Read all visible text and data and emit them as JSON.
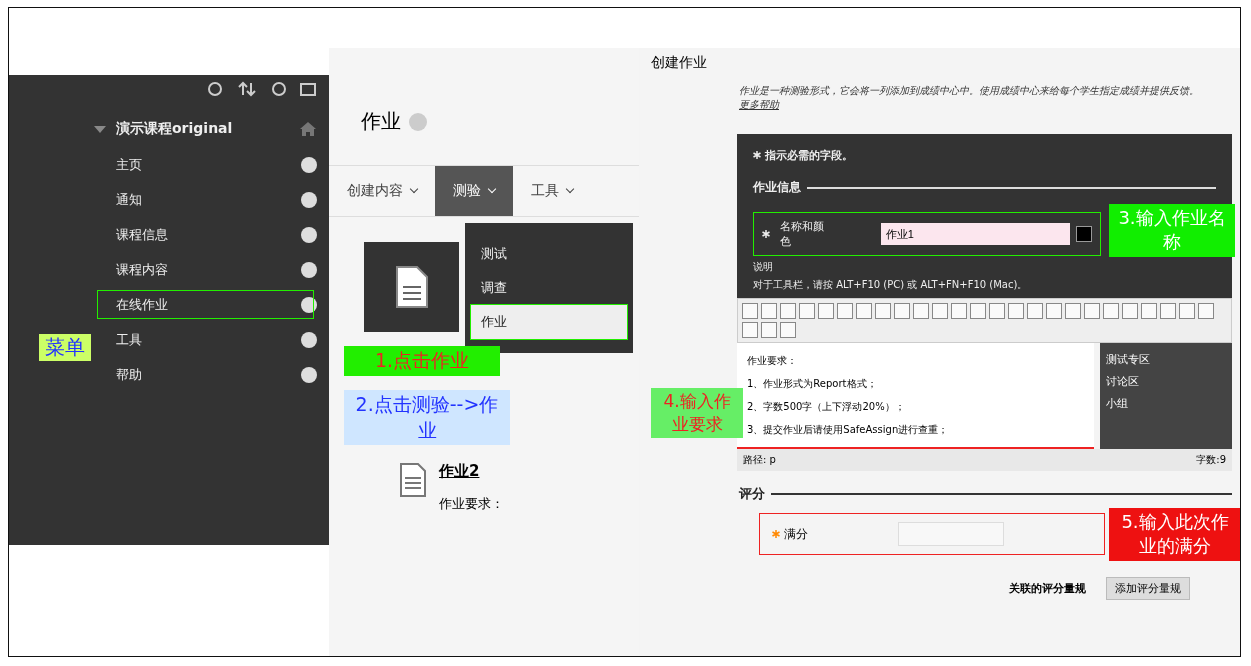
{
  "sidebar": {
    "course": "演示课程original",
    "items": [
      {
        "label": "主页",
        "selected": false
      },
      {
        "label": "通知",
        "selected": false
      },
      {
        "label": "课程信息",
        "selected": false
      },
      {
        "label": "课程内容",
        "selected": false
      },
      {
        "label": "在线作业",
        "selected": true
      },
      {
        "label": "工具",
        "selected": false
      },
      {
        "label": "帮助",
        "selected": false
      }
    ]
  },
  "content": {
    "title": "作业",
    "tabs": [
      {
        "label": "创建内容",
        "selected": false
      },
      {
        "label": "测验",
        "selected": true
      },
      {
        "label": "工具",
        "selected": false
      }
    ],
    "dropdown": [
      {
        "label": "测试",
        "selected": false
      },
      {
        "label": "调查",
        "selected": false
      },
      {
        "label": "作业",
        "selected": true
      }
    ],
    "item": {
      "title": "作业2",
      "text": "作业要求："
    }
  },
  "form": {
    "title": "创建作业",
    "intro": "作业是一种测验形式，它会将一列添加到成绩中心中。使用成绩中心来给每个学生指定成绩并提供反馈。",
    "help_link": "更多帮助",
    "required_note": "指示必需的字段。",
    "section": "作业信息",
    "name_label": "名称和颜色",
    "name_value": "作业1",
    "desc_label": "说明",
    "toolbar_hint": "对于工具栏，请按 ALT+F10 (PC) 或 ALT+FN+F10 (Mac)。",
    "editor_lines": [
      "作业要求：",
      "1、作业形式为Report格式；",
      "2、字数500字（上下浮动20%）；",
      "3、提交作业后请使用SafeAssign进行查重；"
    ],
    "path": "路径: p",
    "word_count": "字数:9",
    "grading_section": "评分",
    "points_label": "满分",
    "rubric_label": "关联的评分量规",
    "rubric_button": "添加评分量规"
  },
  "side_links": [
    "测试专区",
    "讨论区",
    "小组"
  ],
  "menu_label": "菜单",
  "callouts": [
    {
      "text": "1.点击作业",
      "color": "#22ee00"
    },
    {
      "text": "2.点击测验-->作业",
      "color": "#cfe6ff"
    },
    {
      "text": "3.输入作业名称",
      "color": "#11ee00"
    },
    {
      "text": "4.输入作业要求",
      "color": "#66ee66"
    },
    {
      "text": "5.输入此次作业的满分",
      "color": "#ee1111"
    }
  ]
}
